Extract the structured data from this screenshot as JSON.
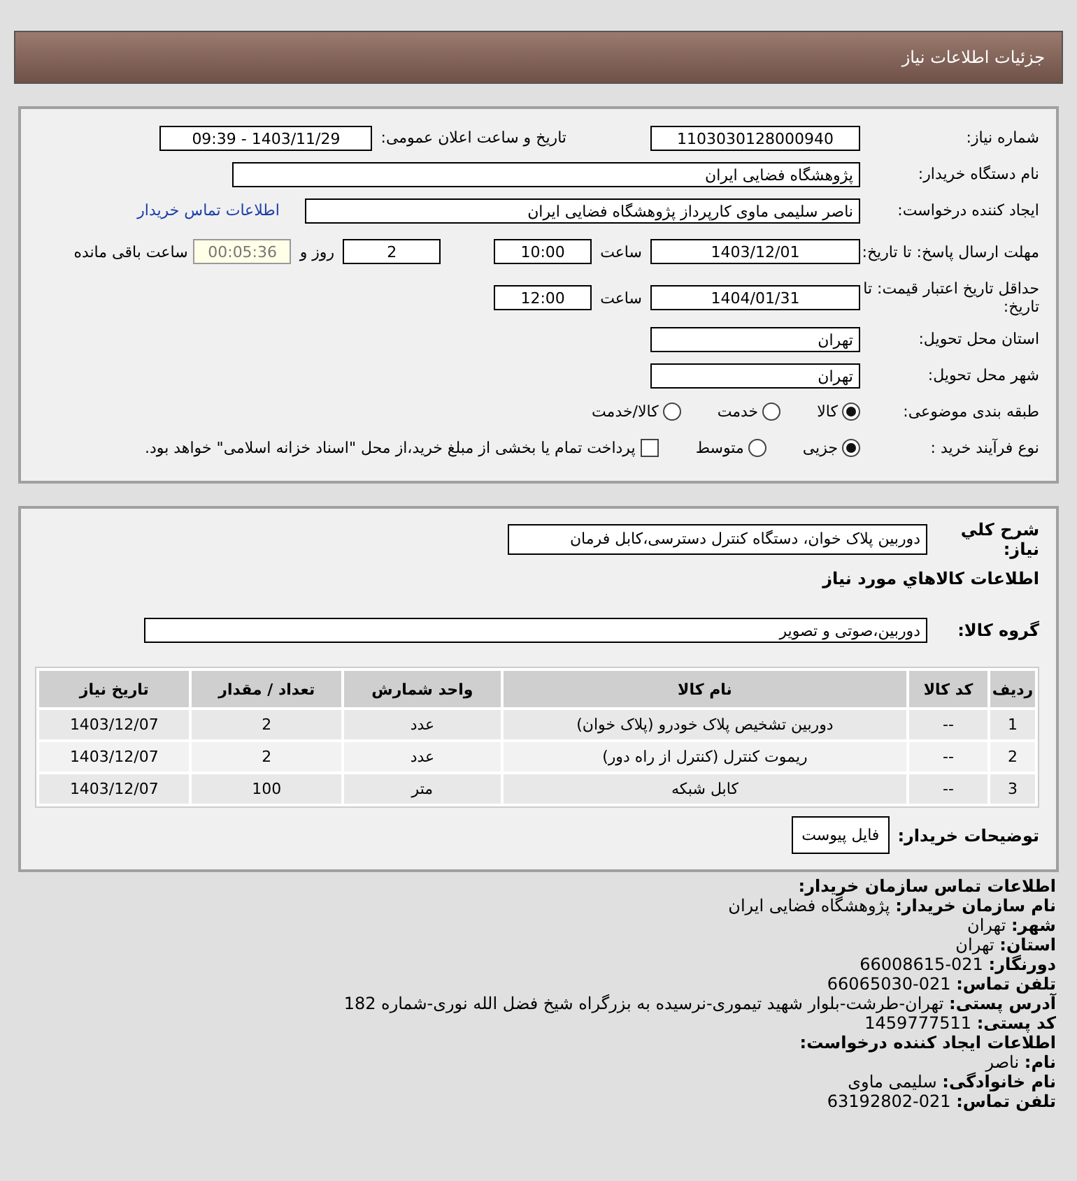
{
  "header": {
    "title": "جزئیات اطلاعات نیاز"
  },
  "need_number": {
    "label": "شماره نیاز:",
    "value": "1103030128000940"
  },
  "announce": {
    "label": "تاریخ و ساعت اعلان عمومی:",
    "value": "1403/11/29 - 09:39"
  },
  "buyer": {
    "label": "نام دستگاه خریدار:",
    "value": "پژوهشگاه فضایی ایران"
  },
  "requester": {
    "label": "ایجاد کننده درخواست:",
    "value": "ناصر سلیمی ماوی کارپرداز پژوهشگاه فضایی ایران",
    "link": "اطلاعات تماس خریدار"
  },
  "deadline": {
    "label": "مهلت ارسال پاسخ: تا تاریخ:",
    "date": "1403/12/01",
    "time_label": "ساعت",
    "time": "10:00",
    "days": "2",
    "days_label": "روز و",
    "remaining": "00:05:36",
    "remaining_label": "ساعت باقی مانده"
  },
  "validity": {
    "label": "حداقل تاریخ اعتبار قیمت: تا تاریخ:",
    "date": "1404/01/31",
    "time_label": "ساعت",
    "time": "12:00"
  },
  "province": {
    "label": "استان محل تحویل:",
    "value": "تهران"
  },
  "city": {
    "label": "شهر محل تحویل:",
    "value": "تهران"
  },
  "category": {
    "label": "طبقه بندی موضوعی:",
    "options": [
      {
        "label": "کالا",
        "selected": true
      },
      {
        "label": "خدمت",
        "selected": false
      },
      {
        "label": "کالا/خدمت",
        "selected": false
      }
    ]
  },
  "process": {
    "label": "نوع فرآیند خرید :",
    "options": [
      {
        "label": "جزیی",
        "selected": true
      },
      {
        "label": "متوسط",
        "selected": false
      }
    ],
    "payment": {
      "checked": false,
      "label": "پرداخت تمام یا بخشی از مبلغ خرید،از محل \"اسناد خزانه اسلامی\" خواهد بود."
    }
  },
  "description": {
    "label": "شرح کلي نياز:",
    "value": "دوربین پلاک خوان، دستگاه کنترل دسترسی،کابل فرمان"
  },
  "goods_title": "اطلاعات کالاهاي مورد نياز",
  "goods_group": {
    "label": "گروه کالا:",
    "value": "دوربین،صوتی و تصویر"
  },
  "table": {
    "columns": [
      "ردیف",
      "کد کالا",
      "نام کالا",
      "واحد شمارش",
      "تعداد / مقدار",
      "تاریخ نیاز"
    ],
    "rows": [
      [
        "1",
        "--",
        "دوربین تشخیص پلاک خودرو (پلاک خوان)",
        "عدد",
        "2",
        "1403/12/07"
      ],
      [
        "2",
        "--",
        "ریموت کنترل (کنترل از راه دور)",
        "عدد",
        "2",
        "1403/12/07"
      ],
      [
        "3",
        "--",
        "کابل شبکه",
        "متر",
        "100",
        "1403/12/07"
      ]
    ]
  },
  "buyer_notes": {
    "label": "توضیحات خریدار:",
    "button": "فایل پیوست"
  },
  "contact_sections": [
    {
      "title": "اطلاعات تماس سازمان خریدار:",
      "lines": [
        {
          "label": "نام سازمان خریدار:",
          "value": "پژوهشگاه فضایی ایران"
        },
        {
          "label": "شهر:",
          "value": "تهران"
        },
        {
          "label": "استان:",
          "value": "تهران"
        },
        {
          "label": "دورنگار:",
          "value": "021-66008615"
        },
        {
          "label": "تلفن تماس:",
          "value": "021-66065030"
        },
        {
          "label": "آدرس پستی:",
          "value": "تهران-طرشت-بلوار شهید تیموری-نرسیده به بزرگراه شیخ فضل الله نوری-شماره 182"
        },
        {
          "label": "کد پستی:",
          "value": "1459777511"
        }
      ]
    },
    {
      "title": "اطلاعات ایجاد کننده درخواست:",
      "lines": [
        {
          "label": "نام:",
          "value": "ناصر"
        },
        {
          "label": "نام خانوادگی:",
          "value": "سلیمی ماوی"
        },
        {
          "label": "تلفن تماس:",
          "value": "021-63192802"
        }
      ]
    }
  ]
}
